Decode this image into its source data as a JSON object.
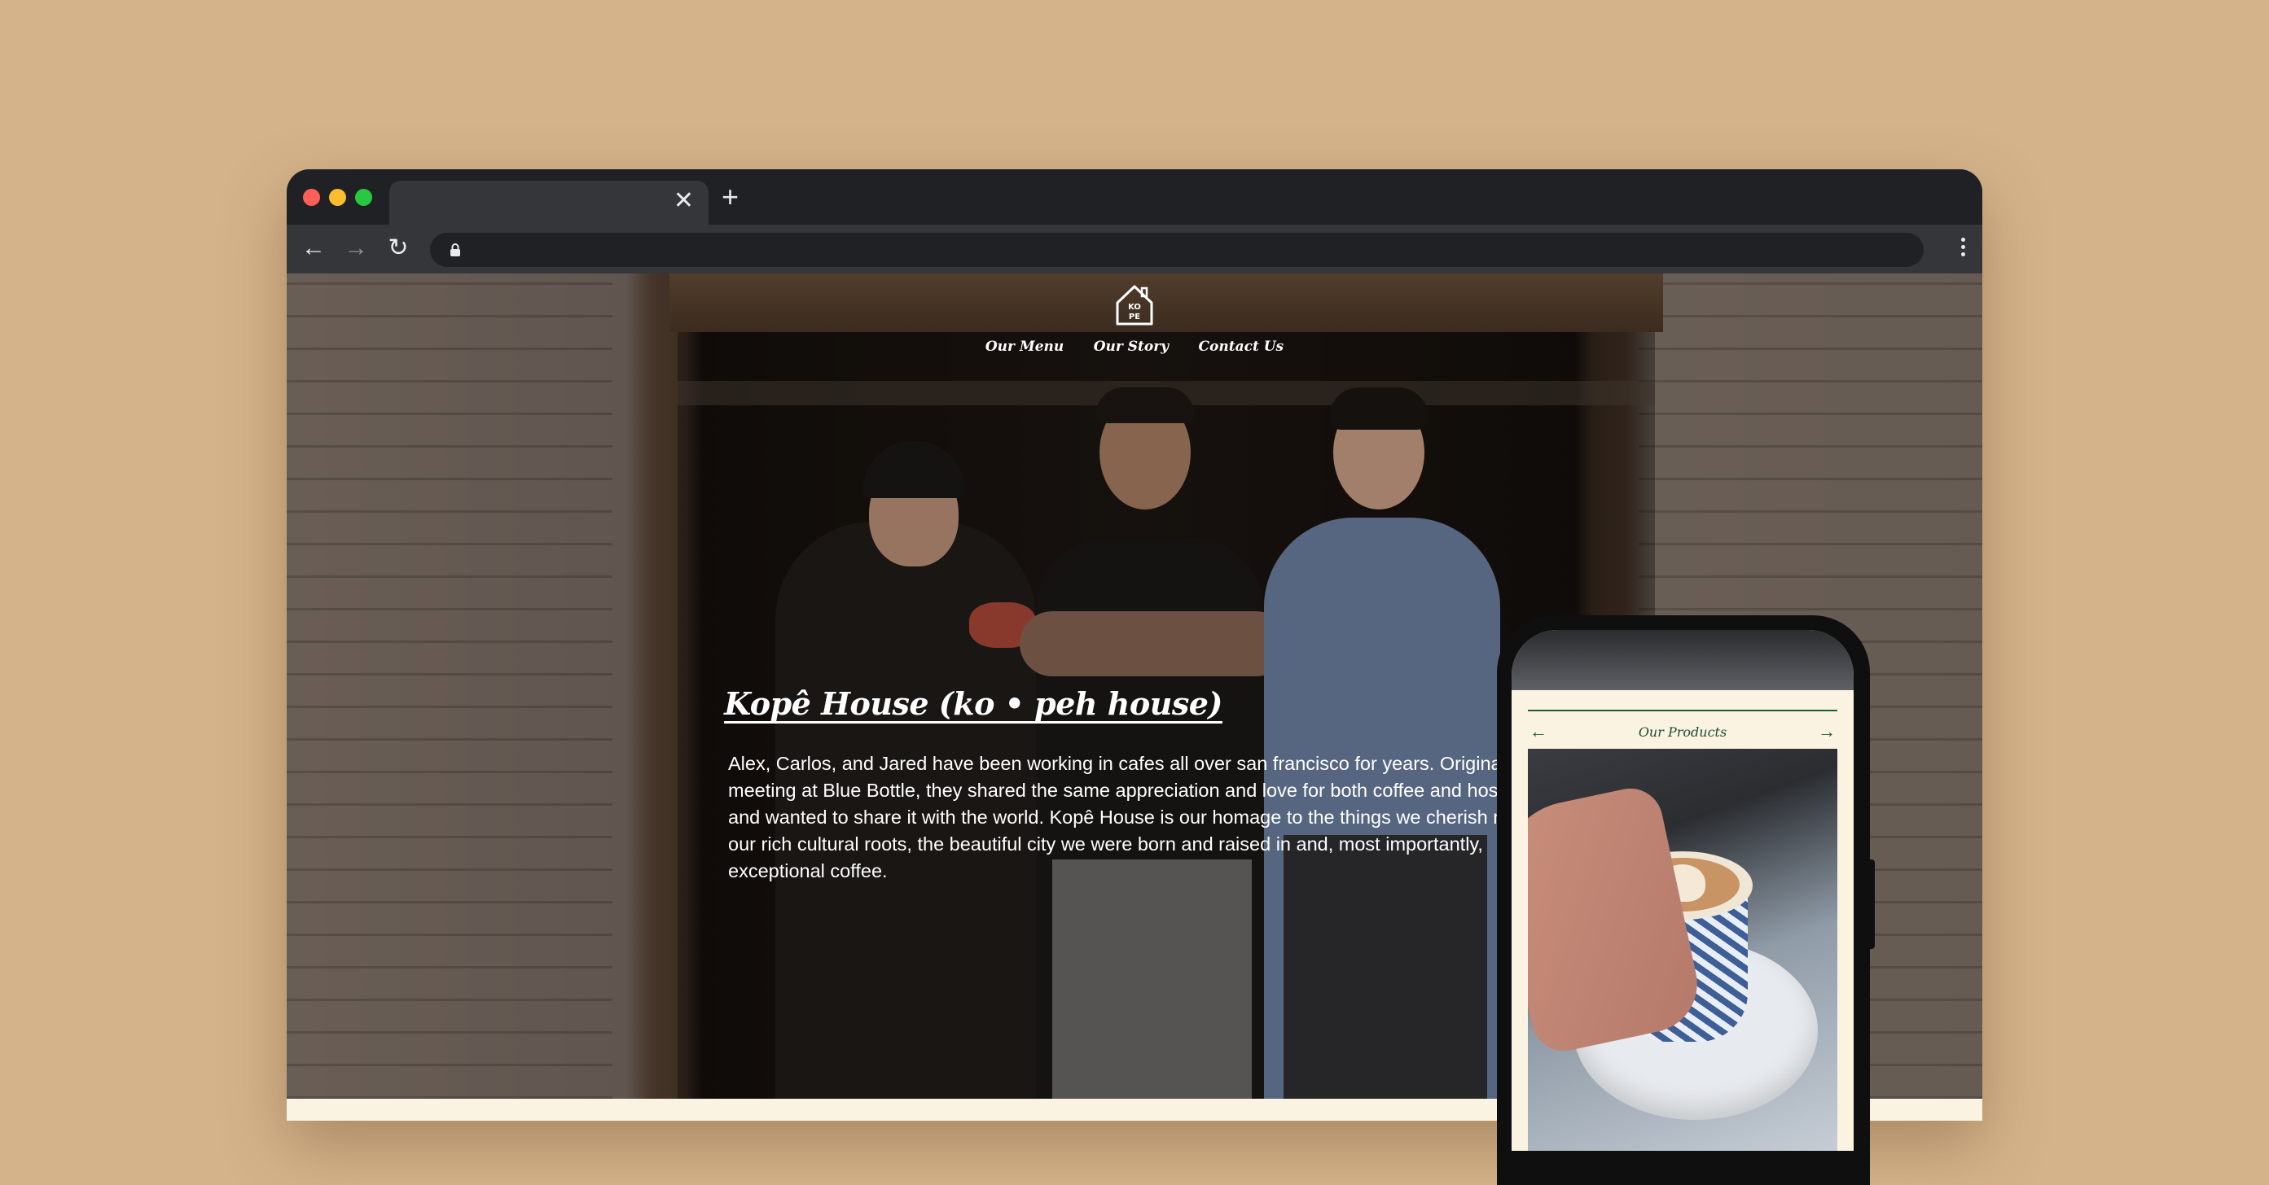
{
  "browser": {
    "tab_title": "",
    "tab_close_glyph": "✕",
    "new_tab_glyph": "+",
    "back_glyph": "←",
    "forward_glyph": "→",
    "reload_glyph": "↻",
    "url": ""
  },
  "site": {
    "logo_text": "KOPE",
    "nav": [
      "Our Menu",
      "Our Story",
      "Contact Us"
    ],
    "hero_title": "Kopê House (ko • peh house)",
    "hero_paragraph_lines": [
      "Alex, Carlos, and Jared have been working in cafes all over san francisco for years. Originally",
      "meeting at Blue Bottle, they shared the same appreciation and love for both coffee and hospi",
      "and wanted to share it with the world. Kopê House is our homage to the things we cherish mo",
      "our rich cultural roots, the beautiful city we were born and raised in and, most importantly,",
      "exceptional coffee."
    ]
  },
  "phone": {
    "section_title": "Our Products",
    "prev_glyph": "←",
    "next_glyph": "→"
  },
  "colors": {
    "page_background": "#d5b38a",
    "browser_chrome": "#202124",
    "cream": "#fbf3e2",
    "brand_green": "#1e5a3a"
  }
}
